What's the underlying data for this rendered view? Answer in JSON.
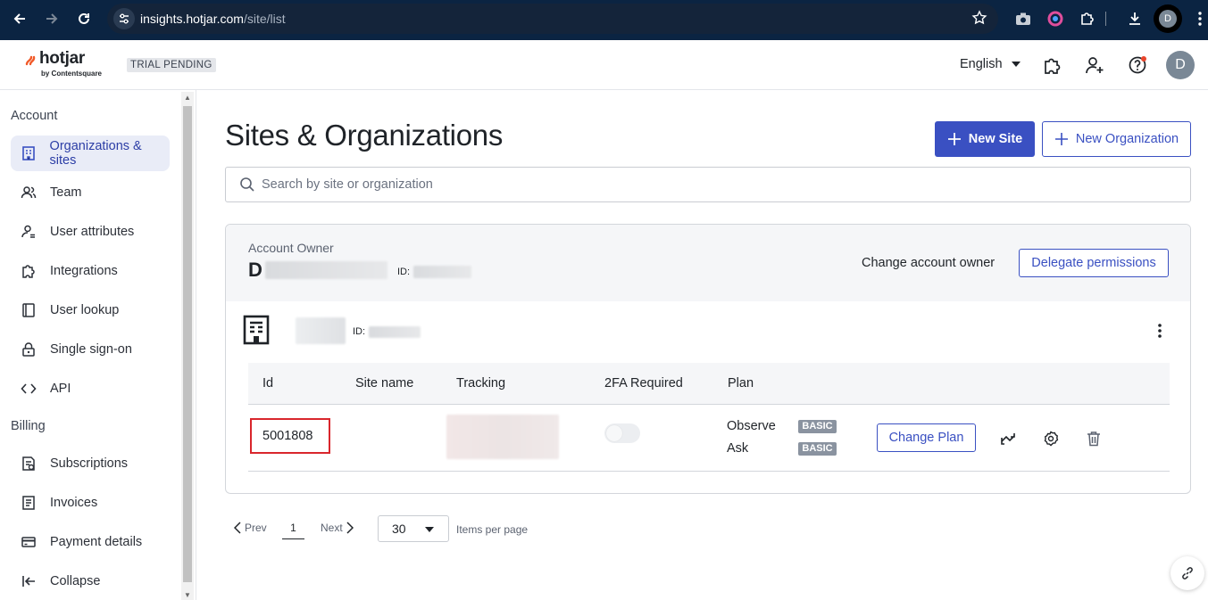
{
  "browser": {
    "url_host": "insights.hotjar.com",
    "url_path": "/site/list",
    "profile_initial": "D"
  },
  "header": {
    "logo_text": "hotjar",
    "logo_sub": "by Contentsquare",
    "trial_badge": "TRIAL PENDING",
    "language": "English",
    "avatar_initial": "D",
    "icons": [
      "integrations-icon",
      "invite-user-icon",
      "help-icon"
    ]
  },
  "sidebar": {
    "sections": {
      "account": "Account",
      "billing": "Billing"
    },
    "items": [
      {
        "label": "Organizations & sites",
        "icon": "building-icon",
        "active": true
      },
      {
        "label": "Team",
        "icon": "team-icon"
      },
      {
        "label": "User attributes",
        "icon": "user-attributes-icon"
      },
      {
        "label": "Integrations",
        "icon": "puzzle-icon"
      },
      {
        "label": "User lookup",
        "icon": "user-lookup-icon"
      },
      {
        "label": "Single sign-on",
        "icon": "lock-icon"
      },
      {
        "label": "API",
        "icon": "code-icon"
      },
      {
        "label": "Subscriptions",
        "icon": "subscriptions-icon"
      },
      {
        "label": "Invoices",
        "icon": "invoice-icon"
      },
      {
        "label": "Payment details",
        "icon": "credit-card-icon"
      },
      {
        "label": "Collapse",
        "icon": "collapse-icon"
      }
    ]
  },
  "main": {
    "title": "Sites & Organizations",
    "new_site_label": "New Site",
    "new_org_label": "New Organization",
    "search_placeholder": "Search by site or organization",
    "account": {
      "label": "Account Owner",
      "initial": "D",
      "id_label": "ID:",
      "change_owner": "Change account owner",
      "delegate": "Delegate permissions"
    },
    "org": {
      "id_label": "ID:"
    },
    "table": {
      "headers": [
        "Id",
        "Site name",
        "Tracking",
        "2FA Required",
        "Plan"
      ],
      "rows": [
        {
          "id": "5001808",
          "site_name": "",
          "twofa": false,
          "plans": [
            {
              "name": "Observe",
              "tier": "BASIC"
            },
            {
              "name": "Ask",
              "tier": "BASIC"
            }
          ],
          "change_plan": "Change Plan"
        }
      ]
    },
    "pagination": {
      "prev": "Prev",
      "page": "1",
      "next": "Next",
      "per_page": "30",
      "per_page_label": "Items per page"
    }
  }
}
